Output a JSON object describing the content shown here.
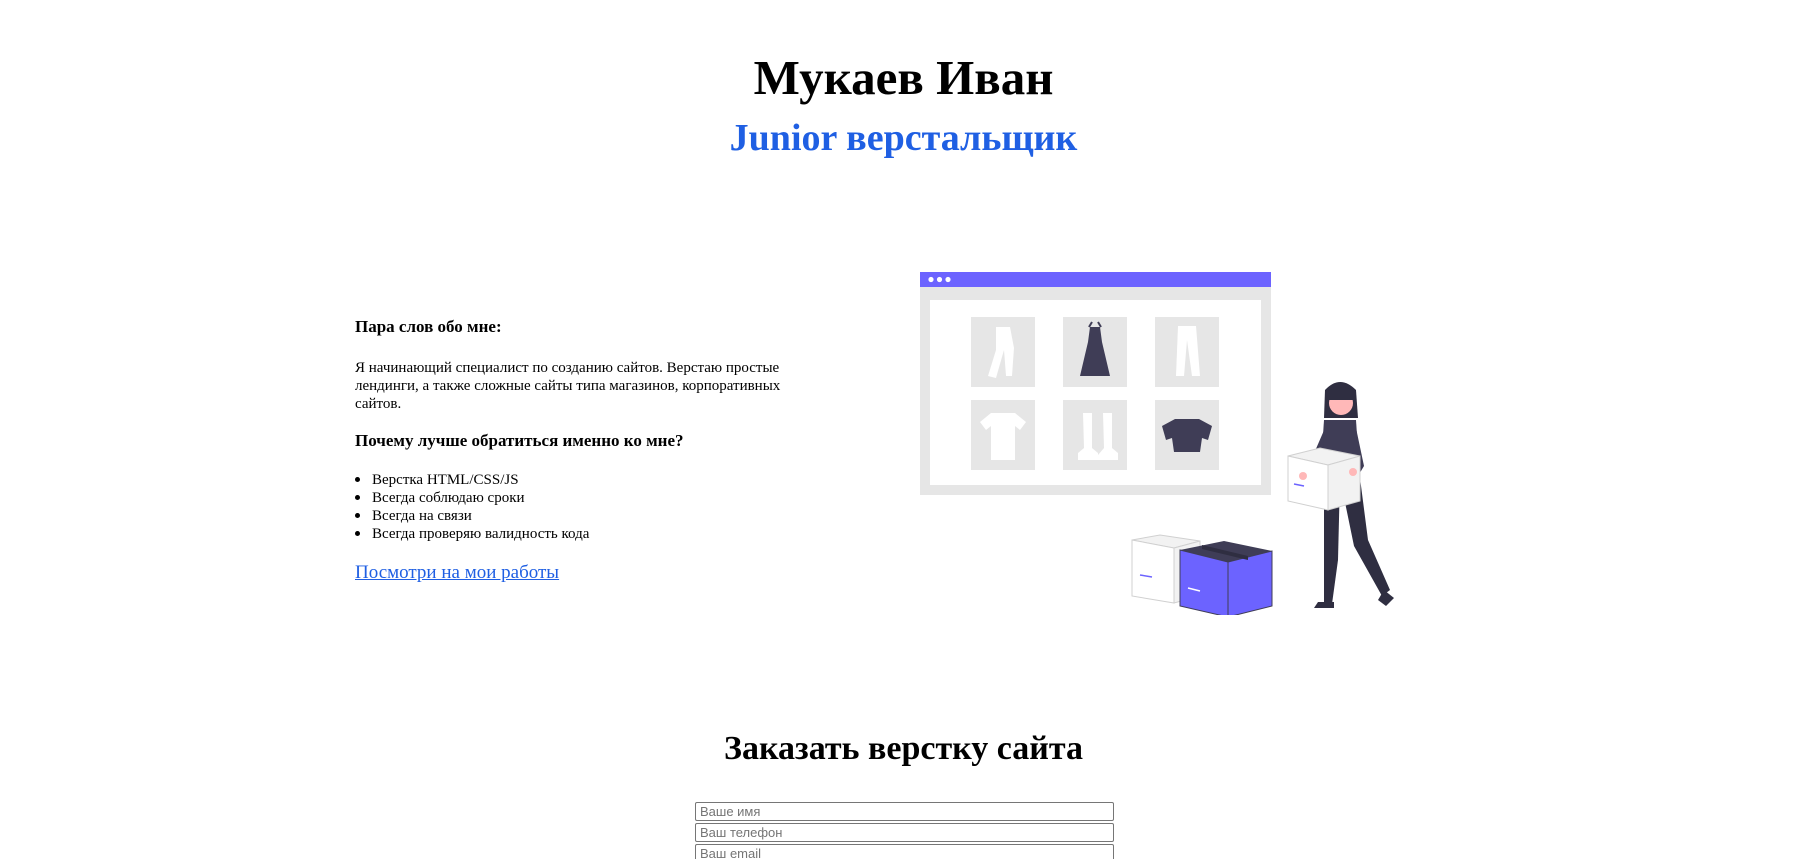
{
  "hero": {
    "name": "Мукаев Иван",
    "role": "Junior верстальщик"
  },
  "about": {
    "heading": "Пара слов обо мне:",
    "bio": "Я начинающий специалист по созданию сайтов. Верстаю простые лендинги, а также сложные сайты типа магазинов, корпоративных сайтов.",
    "why_heading": "Почему лучше обратиться именно ко мне?",
    "benefits": [
      "Верстка HTML/CSS/JS",
      "Всегда соблюдаю сроки",
      "Всегда на связи",
      "Всегда проверяю валидность кода"
    ],
    "works_link": "Посмотри на мои работы"
  },
  "colors": {
    "accent": "#1f5fe3",
    "illustration_purple": "#6c63ff",
    "illustration_dark": "#3f3d56",
    "illustration_gray": "#e6e6e6"
  },
  "illustration": {
    "icon": "online-shop-illustration"
  },
  "order": {
    "title": "Заказать верстку сайта",
    "fields": [
      {
        "placeholder": "Ваше имя"
      },
      {
        "placeholder": "Ваш телефон"
      },
      {
        "placeholder": "Ваш email"
      }
    ]
  }
}
